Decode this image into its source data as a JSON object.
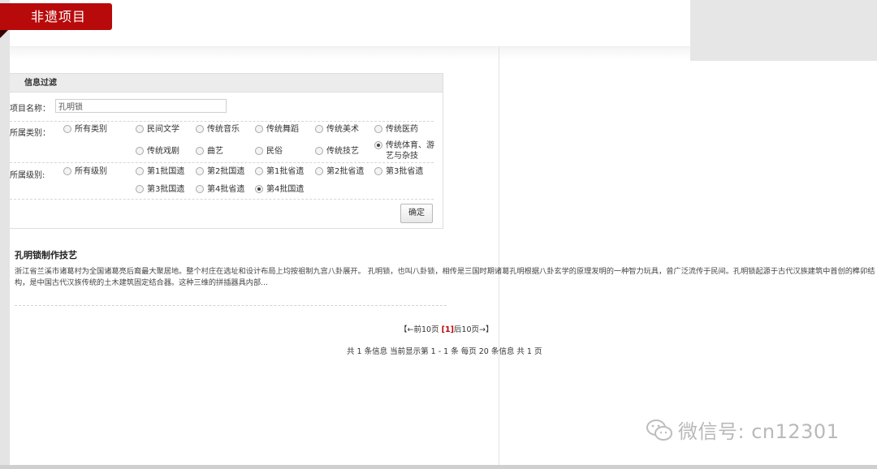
{
  "header": {
    "tab_title": "非遗项目"
  },
  "filter": {
    "title": "信息过滤",
    "name_label": "项目名称：",
    "name_value": "孔明锁",
    "category_label": "所属类别：",
    "categories": [
      {
        "label": "所有类别",
        "checked": false
      },
      {
        "label": "民间文学",
        "checked": false
      },
      {
        "label": "传统音乐",
        "checked": false
      },
      {
        "label": "传统舞蹈",
        "checked": false
      },
      {
        "label": "传统美术",
        "checked": false
      },
      {
        "label": "传统医药",
        "checked": false
      },
      {
        "label": "传统戏剧",
        "checked": false
      },
      {
        "label": "曲艺",
        "checked": false
      },
      {
        "label": "民俗",
        "checked": false
      },
      {
        "label": "传统技艺",
        "checked": false
      },
      {
        "label": "传统体育、游艺与杂技",
        "checked": true
      }
    ],
    "level_label": "所属级别:",
    "levels": [
      {
        "label": "所有级别",
        "checked": false
      },
      {
        "label": "第1批国遗",
        "checked": false
      },
      {
        "label": "第2批国遗",
        "checked": false
      },
      {
        "label": "第1批省遗",
        "checked": false
      },
      {
        "label": "第2批省遗",
        "checked": false
      },
      {
        "label": "第3批省遗",
        "checked": false
      },
      {
        "label": "第3批国遗",
        "checked": false
      },
      {
        "label": "第4批省遗",
        "checked": false
      },
      {
        "label": "第4批国遗",
        "checked": true
      }
    ],
    "confirm_label": "确定"
  },
  "result": {
    "title": "孔明锁制作技艺",
    "description": "浙江省兰溪市诸葛村为全国诸葛亮后裔最大聚居地。整个村庄在选址和设计布局上均按祖制九宫八卦展开。 孔明锁，也叫八卦锁，相传是三国时期诸葛孔明根据八卦玄学的原理发明的一种智力玩具，曾广泛流传于民间。孔明锁起源于古代汉族建筑中首创的榫卯结构，是中国古代汉族传统的土木建筑固定结合器。这种三维的拼插器具内部..."
  },
  "pager": {
    "open": "【",
    "prev": "←前10页",
    "current_open": "[",
    "current": "1",
    "current_close": "]",
    "next": "后10页→",
    "close": "】"
  },
  "summary": "共 1 条信息 当前显示第 1 - 1 条 每页 20 条信息 共 1 页",
  "watermark": {
    "text": "微信号: cn12301",
    "icon": "wechat-icon"
  }
}
